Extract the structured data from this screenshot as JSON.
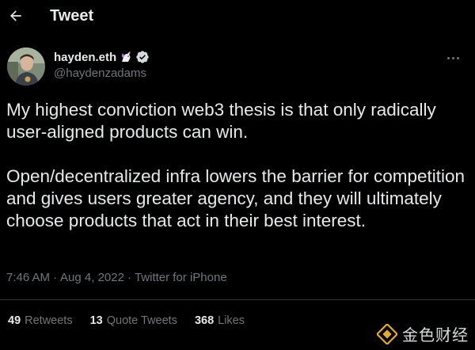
{
  "header": {
    "title": "Tweet"
  },
  "author": {
    "display_name": "hayden.eth",
    "handle": "@haydenzadams"
  },
  "tweet": {
    "paragraphs": [
      "My highest conviction web3 thesis is that only radically user-aligned products can win.",
      "Open/decentralized infra lowers the barrier for competition and gives users greater agency, and they will ultimately choose products that act in their best interest."
    ],
    "time": "7:46 AM",
    "date": "Aug 4, 2022",
    "source": "Twitter for iPhone",
    "separator": "·"
  },
  "stats": {
    "retweets": {
      "count": "49",
      "label": "Retweets"
    },
    "quote_tweets": {
      "count": "13",
      "label": "Quote Tweets"
    },
    "likes": {
      "count": "368",
      "label": "Likes"
    }
  },
  "watermark": {
    "text": "金色财经"
  },
  "icons": {
    "back": "arrow-left-icon",
    "verified": "verified-badge-icon",
    "unicorn": "unicorn-emoji-icon",
    "more": "more-dots-icon"
  },
  "colors": {
    "background": "#000000",
    "text": "#e7e9ea",
    "muted": "#71767b",
    "divider": "#2f3336",
    "watermark_gold": "#e5a92b"
  }
}
